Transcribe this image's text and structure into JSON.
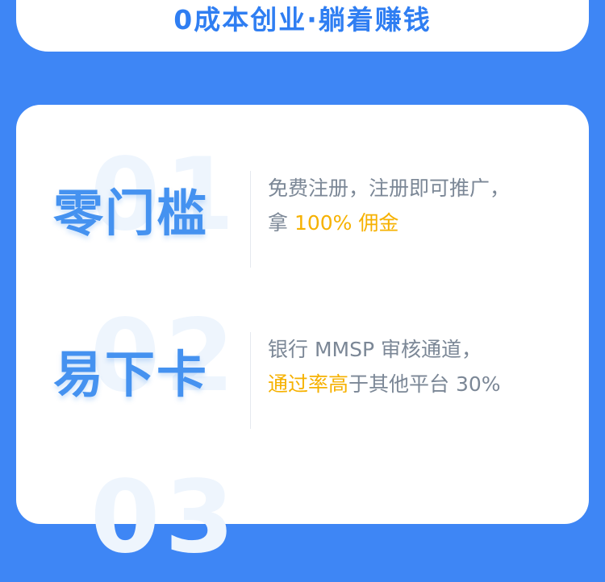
{
  "banner": {
    "slogan": "0成本创业·躺着赚钱"
  },
  "features": [
    {
      "number": "01",
      "title": "零门槛",
      "line1": "免费注册，注册即可推广，",
      "line2_prefix": "拿 ",
      "line2_highlight": "100% 佣金",
      "line2_suffix": ""
    },
    {
      "number": "02",
      "title": "易下卡",
      "line1": "银行 MMSP 审核通道，",
      "line2_prefix": "",
      "line2_highlight": "通过率高",
      "line2_suffix": "于其他平台 30%"
    },
    {
      "number": "03"
    }
  ],
  "colors": {
    "background": "#3e86f5",
    "accent_blue": "#2f7ef2",
    "title_blue": "#4592f0",
    "highlight": "#f6b100",
    "body_text": "#7b8796"
  }
}
